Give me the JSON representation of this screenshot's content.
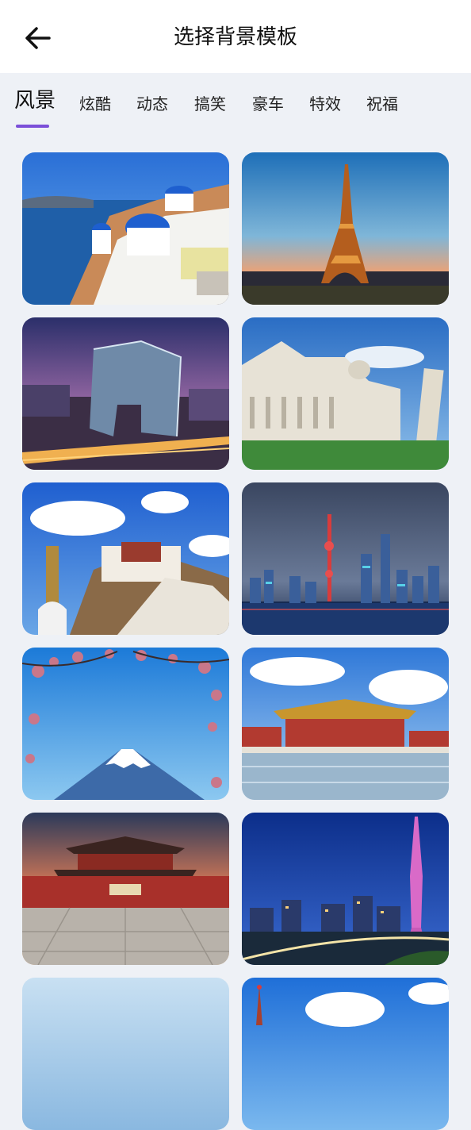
{
  "header": {
    "title": "选择背景模板",
    "back_icon": "arrow-left-icon"
  },
  "tabs": [
    {
      "label": "风景",
      "active": true
    },
    {
      "label": "炫酷",
      "active": false
    },
    {
      "label": "动态",
      "active": false
    },
    {
      "label": "搞笑",
      "active": false
    },
    {
      "label": "豪车",
      "active": false
    },
    {
      "label": "特效",
      "active": false
    },
    {
      "label": "祝福",
      "active": false
    }
  ],
  "accent_color": "#7b4fd8",
  "templates": [
    {
      "id": "santorini"
    },
    {
      "id": "eiffel-tower"
    },
    {
      "id": "cctv-building"
    },
    {
      "id": "pisa-cathedral"
    },
    {
      "id": "potala-palace"
    },
    {
      "id": "shanghai-skyline"
    },
    {
      "id": "mount-fuji"
    },
    {
      "id": "forbidden-city-plaza"
    },
    {
      "id": "forbidden-city-gate"
    },
    {
      "id": "canton-tower"
    },
    {
      "id": "partial-sky"
    },
    {
      "id": "partial-kremlin"
    }
  ]
}
